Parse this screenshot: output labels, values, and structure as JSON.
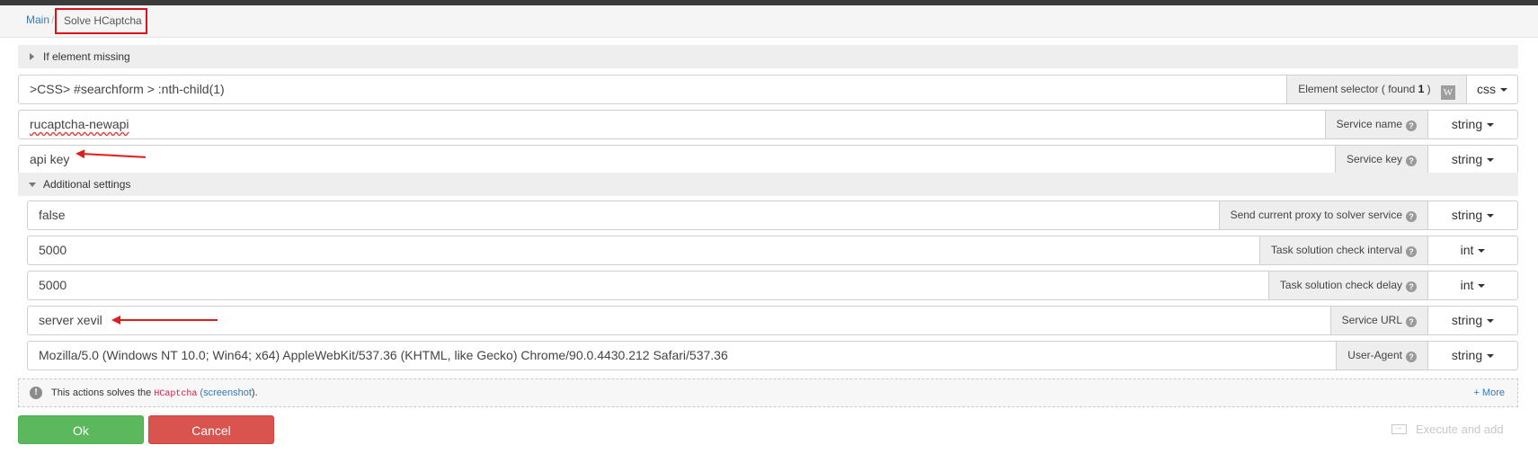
{
  "breadcrumb": {
    "main": "Main",
    "separator": "/",
    "current": "Solve HCaptcha"
  },
  "if_missing": {
    "label": "If element missing"
  },
  "selector_row": {
    "value": ">CSS> #searchform > :nth-child(1)",
    "label_prefix": "Element selector ( found",
    "count": "1",
    "label_suffix": ")",
    "w_icon": "W",
    "type": "css"
  },
  "service_name": {
    "value": "rucaptcha-newapi",
    "label": "Service name",
    "type": "string"
  },
  "service_key": {
    "value": "api key",
    "label": "Service key",
    "type": "string"
  },
  "additional": {
    "label": "Additional settings"
  },
  "send_proxy": {
    "value": "false",
    "label": "Send current proxy to solver service",
    "type": "string"
  },
  "check_interval": {
    "value": "5000",
    "label": "Task solution check interval",
    "type": "int"
  },
  "check_delay": {
    "value": "5000",
    "label": "Task solution check delay",
    "type": "int"
  },
  "service_url": {
    "value": "server xevil",
    "label": "Service URL",
    "type": "string"
  },
  "user_agent": {
    "value": "Mozilla/5.0 (Windows NT 10.0; Win64; x64) AppleWebKit/537.36 (KHTML, like Gecko) Chrome/90.0.4430.212 Safari/537.36",
    "label": "User-Agent",
    "type": "string"
  },
  "info": {
    "icon": "!",
    "text_before": "This actions solves the",
    "code": "HCaptcha",
    "link_open": "(",
    "link": "screenshot",
    "link_close": ").",
    "more": "+ More"
  },
  "buttons": {
    "ok": "Ok",
    "cancel": "Cancel",
    "execute": "Execute and add"
  },
  "help_mark": "?",
  "colors": {
    "ok": "#5cb85c",
    "cancel": "#d9534f",
    "highlight": "#e0101b",
    "link": "#337ab7"
  }
}
